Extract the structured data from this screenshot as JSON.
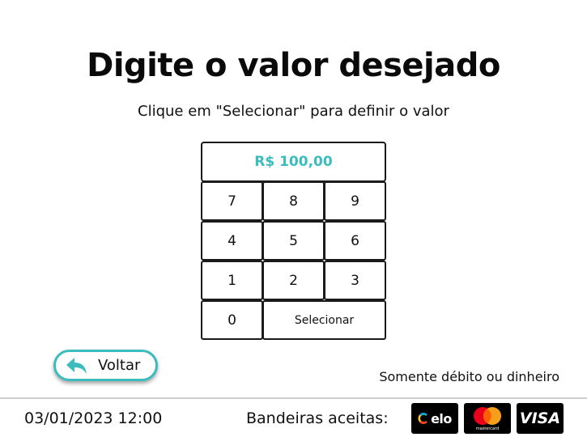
{
  "header": {
    "title": "Digite o valor desejado",
    "subtitle": "Clique em \"Selecionar\" para definir o valor"
  },
  "keypad": {
    "display_value": "R$ 100,00",
    "keys": {
      "k7": "7",
      "k8": "8",
      "k9": "9",
      "k4": "4",
      "k5": "5",
      "k6": "6",
      "k1": "1",
      "k2": "2",
      "k3": "3",
      "k0": "0",
      "select": "Selecionar"
    }
  },
  "back_button": {
    "label": "Voltar",
    "icon": "reply-arrow-icon"
  },
  "payment_notice": "Somente débito ou dinheiro",
  "footer": {
    "datetime": "03/01/2023 12:00",
    "flags_label": "Bandeiras aceitas:",
    "brands": {
      "elo": "elo",
      "mastercard": "mastercard",
      "visa": "VISA"
    }
  },
  "colors": {
    "accent": "#3bbcbf",
    "text": "#111111",
    "border": "#1a1a1a",
    "mastercard_red": "#eb001b",
    "mastercard_orange": "#f79e1b"
  }
}
